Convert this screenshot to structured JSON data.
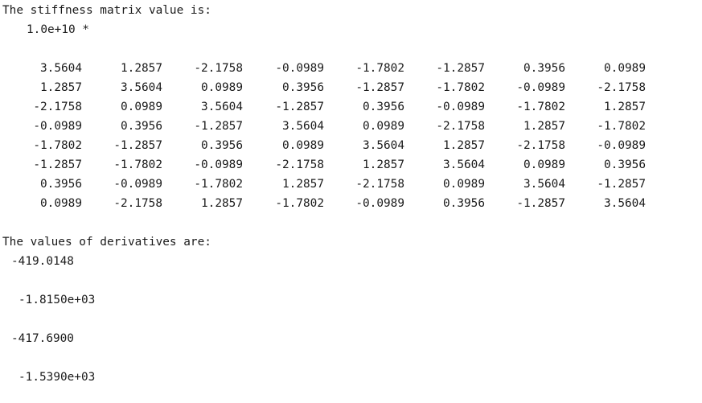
{
  "output": {
    "stiffness_heading": "The stiffness matrix value is:",
    "scale_factor": "1.0e+10 *",
    "matrix": [
      [
        "3.5604",
        "1.2857",
        "-2.1758",
        "-0.0989",
        "-1.7802",
        "-1.2857",
        "0.3956",
        "0.0989"
      ],
      [
        "1.2857",
        "3.5604",
        "0.0989",
        "0.3956",
        "-1.2857",
        "-1.7802",
        "-0.0989",
        "-2.1758"
      ],
      [
        "-2.1758",
        "0.0989",
        "3.5604",
        "-1.2857",
        "0.3956",
        "-0.0989",
        "-1.7802",
        "1.2857"
      ],
      [
        "-0.0989",
        "0.3956",
        "-1.2857",
        "3.5604",
        "0.0989",
        "-2.1758",
        "1.2857",
        "-1.7802"
      ],
      [
        "-1.7802",
        "-1.2857",
        "0.3956",
        "0.0989",
        "3.5604",
        "1.2857",
        "-2.1758",
        "-0.0989"
      ],
      [
        "-1.2857",
        "-1.7802",
        "-0.0989",
        "-2.1758",
        "1.2857",
        "3.5604",
        "0.0989",
        "0.3956"
      ],
      [
        "0.3956",
        "-0.0989",
        "-1.7802",
        "1.2857",
        "-2.1758",
        "0.0989",
        "3.5604",
        "-1.2857"
      ],
      [
        "0.0989",
        "-2.1758",
        "1.2857",
        "-1.7802",
        "-0.0989",
        "0.3956",
        "-1.2857",
        "3.5604"
      ]
    ],
    "derivatives_heading": "The values of derivatives are:",
    "derivatives": [
      "-419.0148",
      "-1.8150e+03",
      "-417.6900",
      "-1.5390e+03"
    ]
  }
}
